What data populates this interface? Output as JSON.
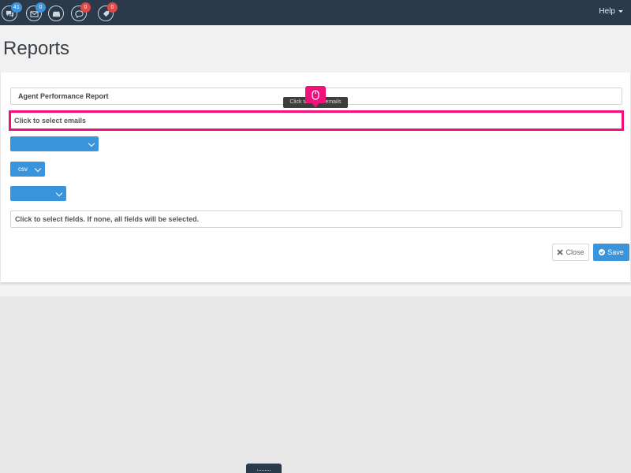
{
  "topbar": {
    "badges": {
      "chats": "41",
      "mail": "0",
      "inbox": "",
      "messages": "0",
      "tags": "0"
    },
    "help_label": "Help"
  },
  "page": {
    "title": "Reports"
  },
  "form": {
    "report_name": "Agent Performance Report",
    "emails_placeholder": "Click to select emails",
    "select_one_value": "",
    "format_value": "csv",
    "select_three_value": "",
    "fields_placeholder": "Click to select fields. If none, all fields will be selected.",
    "close_label": "Close",
    "save_label": "Save"
  },
  "tooltip": {
    "text": "Click to select emails"
  },
  "colors": {
    "topbar": "#2b3a4a",
    "accent": "#3a94dc",
    "highlight": "#f0127a",
    "badge_red": "#e04848"
  }
}
